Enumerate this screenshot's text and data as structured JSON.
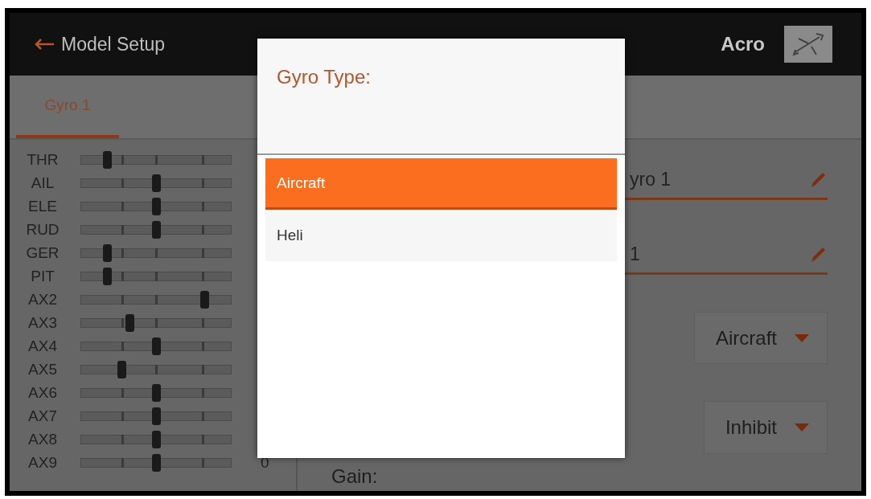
{
  "header": {
    "back_label": "Model Setup",
    "mode": "Acro"
  },
  "tabs": [
    {
      "label": "Gyro 1",
      "selected": true
    }
  ],
  "channels": [
    {
      "name": "THR",
      "level": 0.17
    },
    {
      "name": "AIL",
      "level": 0.5
    },
    {
      "name": "ELE",
      "level": 0.5
    },
    {
      "name": "RUD",
      "level": 0.5
    },
    {
      "name": "GER",
      "level": 0.17
    },
    {
      "name": "PIT",
      "level": 0.17
    },
    {
      "name": "AX2",
      "level": 0.82
    },
    {
      "name": "AX3",
      "level": 0.32
    },
    {
      "name": "AX4",
      "level": 0.5
    },
    {
      "name": "AX5",
      "level": 0.27
    },
    {
      "name": "AX6",
      "level": 0.5
    },
    {
      "name": "AX7",
      "level": 0.5
    },
    {
      "name": "AX8",
      "level": 0.5
    },
    {
      "name": "AX9",
      "level": 0.5,
      "value": "0"
    }
  ],
  "settings": {
    "fields": [
      {
        "value": "yro 1"
      },
      {
        "value": "1"
      }
    ],
    "dropdowns": [
      {
        "value": "Aircraft"
      },
      {
        "value": "Inhibit"
      }
    ],
    "gain_label": "Gain:"
  },
  "dialog": {
    "title": "Gyro Type:",
    "options": [
      {
        "label": "Aircraft",
        "selected": true
      },
      {
        "label": "Heli",
        "selected": false
      }
    ]
  }
}
